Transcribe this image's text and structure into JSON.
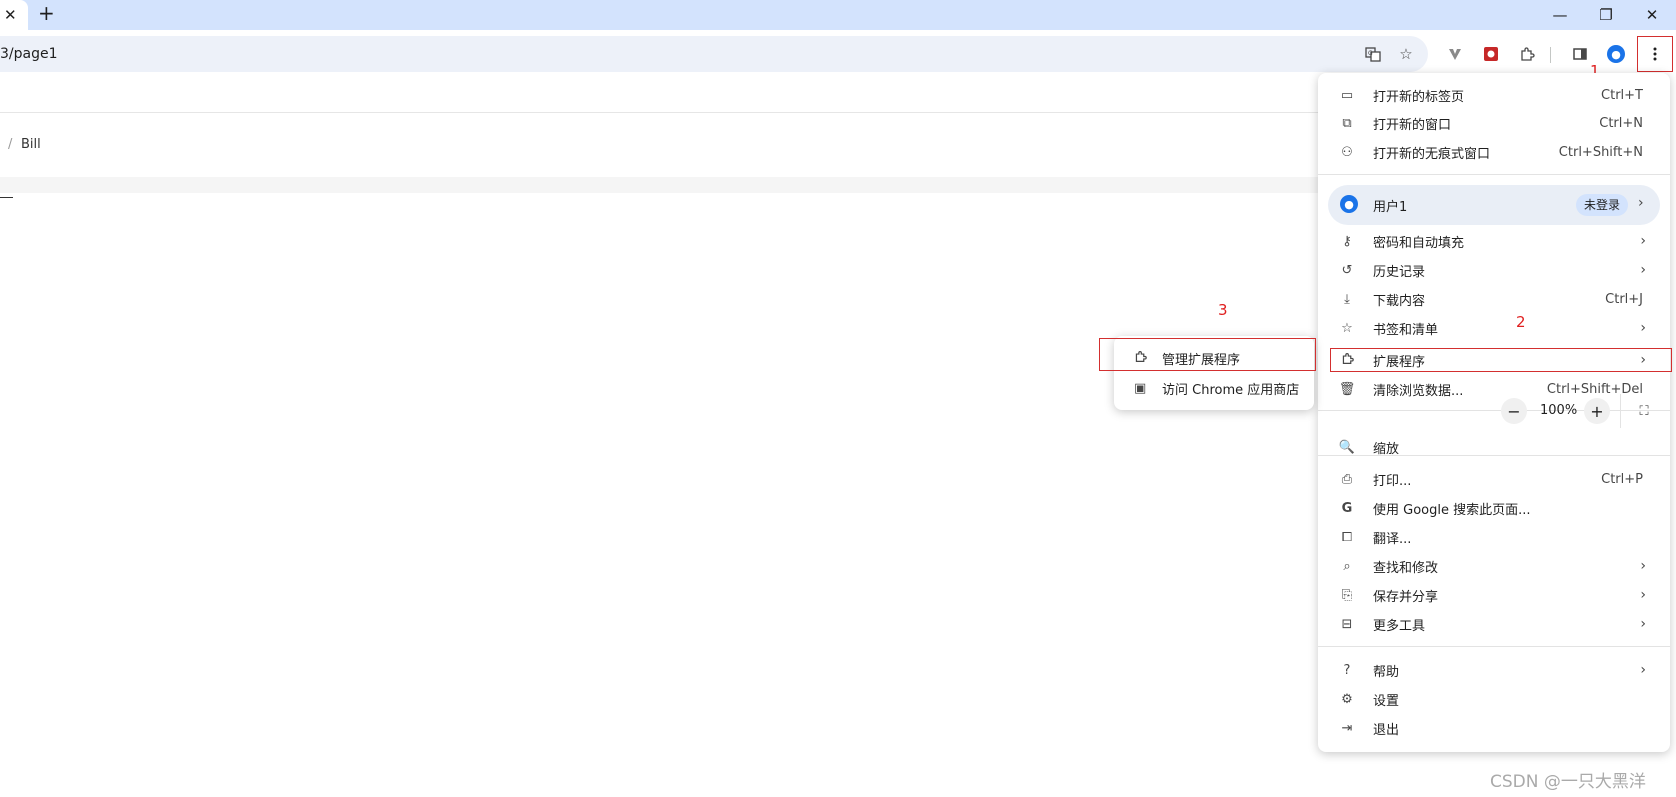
{
  "tabstrip": {
    "tab_close_icon": "✕",
    "new_tab_icon": "+",
    "minimize_icon": "—",
    "restore_icon": "❐",
    "close_icon": "✕"
  },
  "toolbar": {
    "url": "3/page1",
    "icons": [
      "translate-icon",
      "star-icon",
      "vimium-icon",
      "red-extension-icon",
      "puzzle-icon",
      "sidebar-icon",
      "avatar-icon",
      "more-vert-icon"
    ]
  },
  "page": {
    "breadcrumb_sep": "/",
    "breadcrumb_item": "Bill"
  },
  "menu": {
    "new_tab": {
      "label": "打开新的标签页",
      "shortcut": "Ctrl+T"
    },
    "new_window": {
      "label": "打开新的窗口",
      "shortcut": "Ctrl+N"
    },
    "incognito": {
      "label": "打开新的无痕式窗口",
      "shortcut": "Ctrl+Shift+N"
    },
    "profile": {
      "label": "用户1",
      "badge": "未登录"
    },
    "passwords": {
      "label": "密码和自动填充"
    },
    "history": {
      "label": "历史记录"
    },
    "downloads": {
      "label": "下载内容",
      "shortcut": "Ctrl+J"
    },
    "bookmarks": {
      "label": "书签和清单"
    },
    "extensions": {
      "label": "扩展程序"
    },
    "clear_data": {
      "label": "清除浏览数据...",
      "shortcut": "Ctrl+Shift+Del"
    },
    "zoom": {
      "label": "缩放",
      "value": "100%",
      "minus": "−",
      "plus": "+"
    },
    "print": {
      "label": "打印...",
      "shortcut": "Ctrl+P"
    },
    "google_search": {
      "label": "使用 Google 搜索此页面..."
    },
    "translate": {
      "label": "翻译..."
    },
    "find_edit": {
      "label": "查找和修改"
    },
    "save_share": {
      "label": "保存并分享"
    },
    "more_tools": {
      "label": "更多工具"
    },
    "help": {
      "label": "帮助"
    },
    "settings": {
      "label": "设置"
    },
    "exit": {
      "label": "退出"
    }
  },
  "submenu": {
    "manage_extensions": "管理扩展程序",
    "visit_store": "访问 Chrome 应用商店"
  },
  "annotations": {
    "one": "1",
    "two": "2",
    "three": "3"
  },
  "watermark": "CSDN @一只大黑洋",
  "colors": {
    "accent": "#1a73e8",
    "annotation": "#d32f2f",
    "tabstrip": "#d3e3fd",
    "omnibox": "#edf1f9"
  }
}
